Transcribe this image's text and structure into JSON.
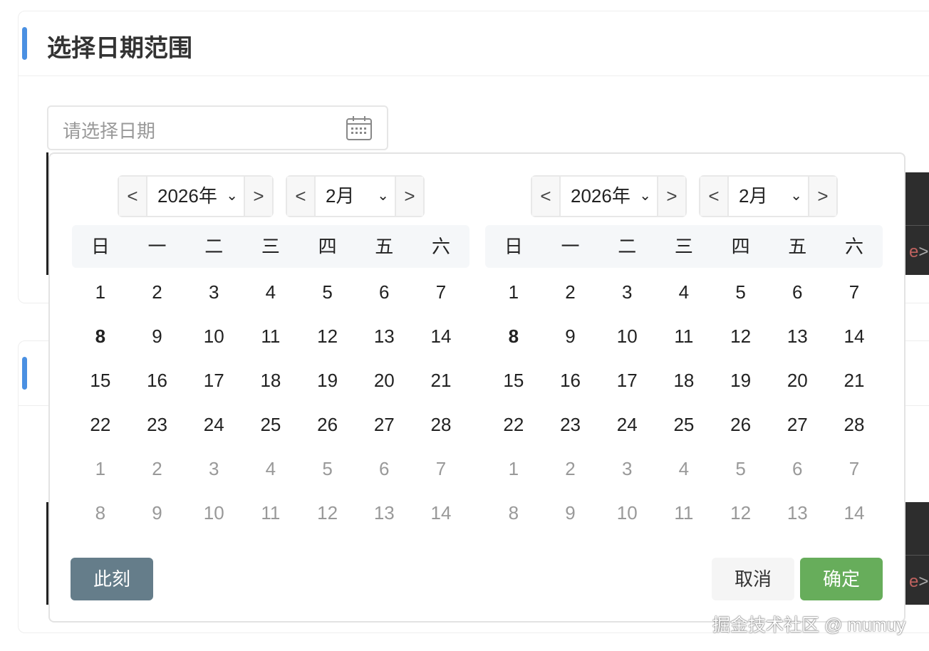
{
  "card1": {
    "title": "选择日期范围",
    "input_placeholder": "请选择日期"
  },
  "background_link": "e",
  "background_arrow": ">",
  "picker": {
    "weekdays": [
      "日",
      "一",
      "二",
      "三",
      "四",
      "五",
      "六"
    ],
    "left": {
      "year": "2026年",
      "month": "2月"
    },
    "right": {
      "year": "2026年",
      "month": "2月"
    },
    "prev": "<",
    "next": ">",
    "chevron": "⌄",
    "weeks": [
      [
        "1",
        "2",
        "3",
        "4",
        "5",
        "6",
        "7"
      ],
      [
        "8",
        "9",
        "10",
        "11",
        "12",
        "13",
        "14"
      ],
      [
        "15",
        "16",
        "17",
        "18",
        "19",
        "20",
        "21"
      ],
      [
        "22",
        "23",
        "24",
        "25",
        "26",
        "27",
        "28"
      ],
      [
        "1",
        "2",
        "3",
        "4",
        "5",
        "6",
        "7"
      ],
      [
        "8",
        "9",
        "10",
        "11",
        "12",
        "13",
        "14"
      ]
    ],
    "other_month_rows": [
      4,
      5
    ],
    "today": "8",
    "now_label": "此刻",
    "cancel_label": "取消",
    "ok_label": "确定"
  },
  "colors": {
    "accent": "#4a90e2",
    "ok": "#67ad5b",
    "now": "#657d8a"
  },
  "watermark": "掘金技术社区 @ mumuy"
}
